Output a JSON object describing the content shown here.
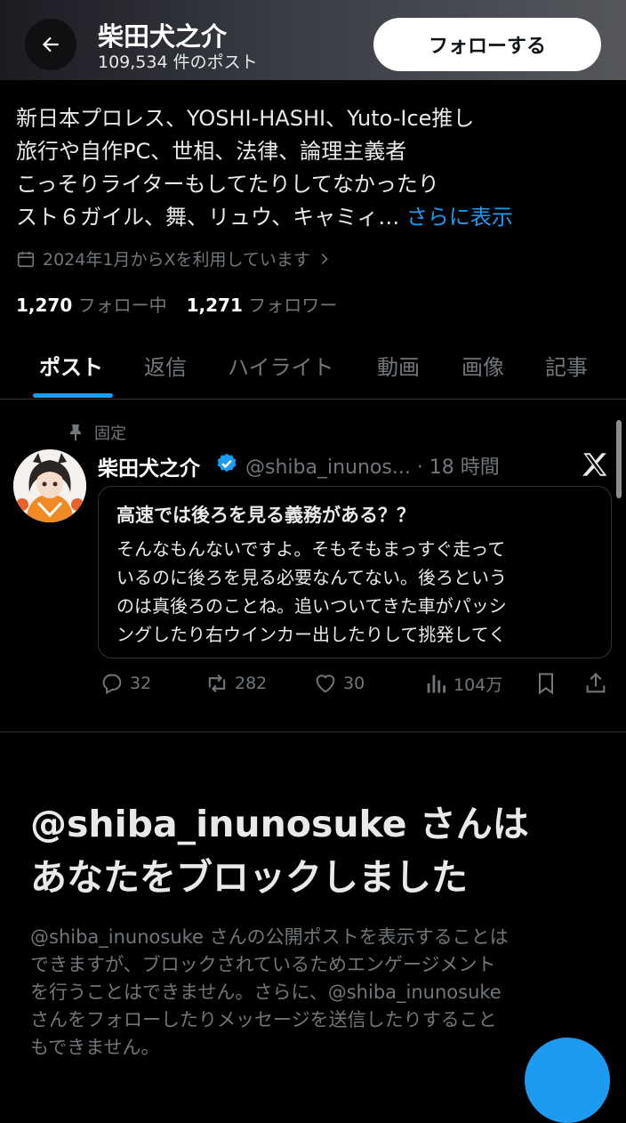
{
  "header": {
    "name": "柴田犬之介",
    "post_count": "109,534 件のポスト",
    "follow_label": "フォローする"
  },
  "bio": {
    "lines": [
      "新日本プロレス、YOSHI-HASHI、Yuto-Ice推し",
      "旅行や自作PC、世相、法律、論理主義者",
      "こっそりライターもしてたりしてなかったり",
      "スト６ガイル、舞、リュウ、キャミィ…"
    ],
    "show_more": "さらに表示"
  },
  "joined": "2024年1月からXを利用しています",
  "stats": {
    "following_count": "1,270",
    "following_label": "フォロー中",
    "followers_count": "1,271",
    "followers_label": "フォロワー"
  },
  "tabs": [
    {
      "label": "ポスト",
      "active": true
    },
    {
      "label": "返信"
    },
    {
      "label": "ハイライト"
    },
    {
      "label": "動画"
    },
    {
      "label": "画像"
    },
    {
      "label": "記事"
    }
  ],
  "post": {
    "pinned_label": "固定",
    "author_name": "柴田犬之介",
    "handle": "@shiba_inunos...",
    "time": "· 18 時間",
    "quote": {
      "title": "高速では後ろを見る義務がある？？",
      "lines": [
        "そんなもんないですよ。そもそもまっすぐ走って",
        "いるのに後ろを見る必要なんてない。後ろという",
        "のは真後ろのことね。追いついてきた車がパッシ",
        "ングしたり右ウインカー出したりして挑発してく"
      ]
    },
    "replies": "32",
    "reposts": "282",
    "likes": "30",
    "views": "104万"
  },
  "block_notice": {
    "title_line1": "@shiba_inunosuke さんは",
    "title_line2": "あなたをブロックしました",
    "desc_lines": [
      "@shiba_inunosuke さんの公開ポストを表示することは",
      "できますが、ブロックされているためエンゲージメント",
      "を行うことはできません。さらに、@shiba_inunosuke",
      "さんをフォローしたりメッセージを送信したりすること",
      "もできません。"
    ]
  },
  "colors": {
    "accent": "#1d9bf0",
    "muted": "#71767b",
    "background": "#000000"
  }
}
